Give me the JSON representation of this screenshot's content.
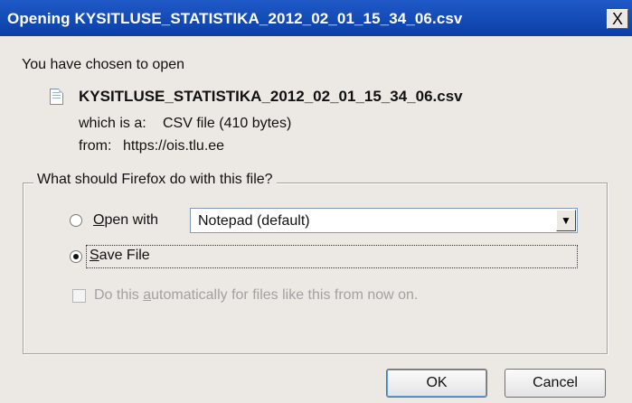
{
  "window": {
    "title": "Opening KYSITLUSE_STATISTIKA_2012_02_01_15_34_06.csv",
    "close_label": "X"
  },
  "intro_text": "You have chosen to open",
  "file": {
    "icon": "document-icon",
    "name": "KYSITLUSE_STATISTIKA_2012_02_01_15_34_06.csv",
    "type_label": "which is a:",
    "type_value": "CSV file (410 bytes)",
    "from_label": "from:",
    "from_value": "https://ois.tlu.ee"
  },
  "action_group": {
    "legend": "What should Firefox do with this file?",
    "open_with": {
      "label_accel": "O",
      "label_rest": "pen with",
      "selected": false
    },
    "application_select": {
      "value": "Notepad (default)",
      "arrow_icon": "chevron-down-icon"
    },
    "save_file": {
      "label_accel": "S",
      "label_rest": "ave File",
      "selected": true
    },
    "auto_checkbox": {
      "label_before": "Do this ",
      "label_accel": "a",
      "label_after": "utomatically for files like this from now on.",
      "checked": false,
      "disabled": true
    }
  },
  "buttons": {
    "ok_label": "OK",
    "cancel_label": "Cancel"
  }
}
